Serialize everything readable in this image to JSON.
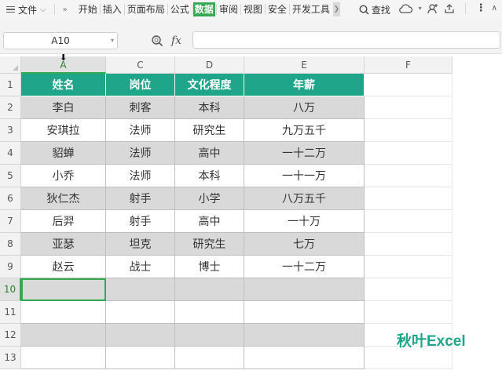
{
  "menu": {
    "file_label": "文件",
    "more_label": "»",
    "tabs": [
      {
        "label": "开始",
        "active": false
      },
      {
        "label": "插入",
        "active": false
      },
      {
        "label": "页面布局",
        "active": false
      },
      {
        "label": "公式",
        "active": false
      },
      {
        "label": "数据",
        "active": true
      },
      {
        "label": "审阅",
        "active": false
      },
      {
        "label": "视图",
        "active": false
      },
      {
        "label": "安全",
        "active": false
      },
      {
        "label": "开发工具",
        "active": false
      }
    ],
    "search_label": "查找"
  },
  "formula_bar": {
    "name_box": "A10",
    "fx_label": "fx",
    "formula_value": ""
  },
  "columns": [
    "A",
    "C",
    "D",
    "E",
    "F"
  ],
  "rows": [
    "1",
    "2",
    "3",
    "4",
    "5",
    "6",
    "7",
    "8",
    "9",
    "10",
    "11",
    "12",
    "13"
  ],
  "table": {
    "headers": [
      "姓名",
      "岗位",
      "文化程度",
      "年薪"
    ],
    "rows": [
      [
        "李白",
        "刺客",
        "本科",
        "八万"
      ],
      [
        "安琪拉",
        "法师",
        "研究生",
        "九万五千"
      ],
      [
        "貂蝉",
        "法师",
        "高中",
        "一十二万"
      ],
      [
        "小乔",
        "法师",
        "本科",
        "一十一万"
      ],
      [
        "狄仁杰",
        "射手",
        "小学",
        "八万五千"
      ],
      [
        "后羿",
        "射手",
        "高中",
        "一十万"
      ],
      [
        "亚瑟",
        "坦克",
        "研究生",
        "七万"
      ],
      [
        "赵云",
        "战士",
        "博士",
        "一十二万"
      ]
    ]
  },
  "colors": {
    "header_fill": "#1fa58a",
    "accent": "#34a853",
    "shade": "#d9d9d9"
  },
  "watermark": "秋叶Excel"
}
